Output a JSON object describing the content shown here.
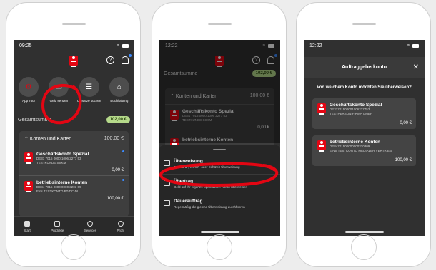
{
  "phone1": {
    "time": "09:25",
    "quick_actions": [
      {
        "label": "App Tour",
        "icon": "app-tour-icon",
        "glyph": "⚙"
      },
      {
        "label": "Geld senden",
        "icon": "send-money-icon",
        "glyph": "▭"
      },
      {
        "label": "Umsätze suchen",
        "icon": "search-transactions-icon",
        "glyph": "☰"
      },
      {
        "label": "Buchhaltung",
        "icon": "accounting-icon",
        "glyph": "⌂"
      }
    ],
    "total_label": "Gesamtsumme",
    "total_value": "102,00 €",
    "section_title": "Konten und Karten",
    "section_value": "100,00 €",
    "accounts": [
      {
        "name": "Geschäftskonto Spezial",
        "iban": "DE31 7015 0000 1006 2277 53",
        "holder": "TESTKUNDE SSKM",
        "balance": "0,00 €"
      },
      {
        "name": "betriebsinterne Konten",
        "iban": "DE84 7015 0000 0000 3203 09",
        "holder": "Eins TESTKONTO PT-DC-DL",
        "balance": "100,00 €"
      }
    ],
    "nav": [
      {
        "label": "Start",
        "icon": "home-icon"
      },
      {
        "label": "Produkte",
        "icon": "products-icon"
      },
      {
        "label": "Services",
        "icon": "services-icon"
      },
      {
        "label": "Profil",
        "icon": "profile-icon"
      }
    ]
  },
  "phone2": {
    "time": "12:22",
    "total_label": "Gesamtsumme",
    "total_value": "102,00 €",
    "section_title": "Konten und Karten",
    "section_value": "100,00 €",
    "account": {
      "name": "Geschäftskonto Spezial",
      "iban": "DE31 7015 0000 1006 2277 53",
      "holder": "TESTKUNDE SSKM",
      "balance": "0,00 €"
    },
    "account2_name": "betriebsinterne Konten",
    "options": [
      {
        "title": "Überweisung",
        "sub": "Standard-, Termin- oder Echtzeit-Überweisung",
        "icon": "transfer-icon"
      },
      {
        "title": "Übertrag",
        "sub": "Geld auf Ihr eigenes Sparkassen-Konto überweisen",
        "icon": "internal-transfer-icon"
      },
      {
        "title": "Dauerauftrag",
        "sub": "Regelmäßig die gleiche Überweisung durchführen",
        "icon": "standing-order-icon"
      }
    ]
  },
  "phone3": {
    "time": "12:22",
    "title": "Auftraggeberkonto",
    "question": "Von welchem Konto möchten Sie überweisen?",
    "accounts": [
      {
        "name": "Geschäftskonto Spezial",
        "iban": "DE31701500001006227753",
        "holder": "TESTPERSON FIRMA GMBH",
        "balance": "0,00 €"
      },
      {
        "name": "betriebsinterne Konten",
        "iban": "DE84701500000000320309",
        "holder": "EINS TESTKONTO MEDIALER VERTRIEB",
        "balance": "100,00 €"
      }
    ]
  },
  "colors": {
    "accent_red": "#e30613",
    "pill_green": "#b5d98a",
    "badge_blue": "#3d8bfd"
  }
}
